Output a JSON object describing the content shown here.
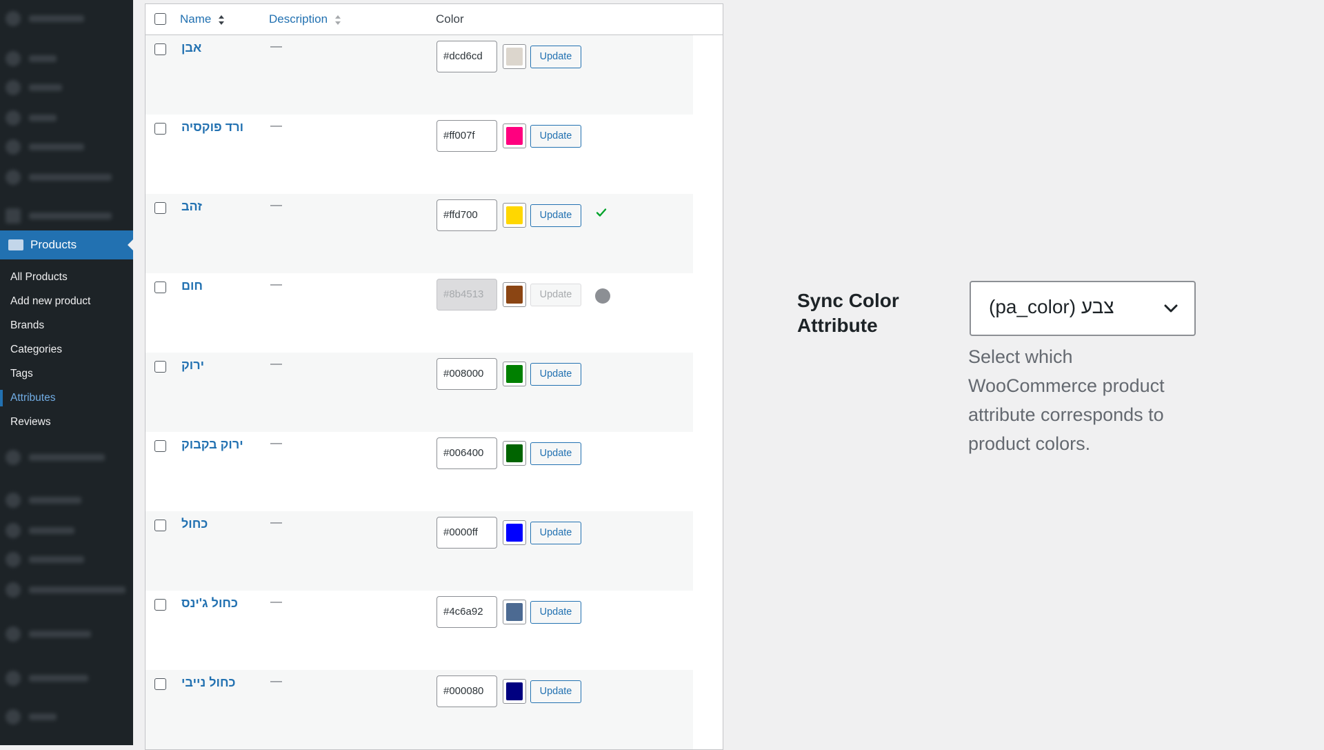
{
  "sidebar": {
    "products_label": "Products",
    "submenu": [
      {
        "label": "All Products"
      },
      {
        "label": "Add new product"
      },
      {
        "label": "Brands"
      },
      {
        "label": "Categories"
      },
      {
        "label": "Tags"
      },
      {
        "label": "Attributes",
        "active": true
      },
      {
        "label": "Reviews"
      }
    ]
  },
  "table": {
    "columns": {
      "name": "Name",
      "description": "Description",
      "color": "Color"
    },
    "update_label": "Update",
    "rows": [
      {
        "name": "אבן",
        "description": "—",
        "hex": "#dcd6cd",
        "swatch": "#dcd6cd",
        "status": "none"
      },
      {
        "name": "ורד פוקסיה",
        "description": "—",
        "hex": "#ff007f",
        "swatch": "#ff007f",
        "status": "none"
      },
      {
        "name": "זהב",
        "description": "—",
        "hex": "#ffd700",
        "swatch": "#ffd700",
        "status": "success"
      },
      {
        "name": "חום",
        "description": "—",
        "hex": "#8b4513",
        "swatch": "#8b4513",
        "status": "loading",
        "disabled": true
      },
      {
        "name": "ירוק",
        "description": "—",
        "hex": "#008000",
        "swatch": "#008000",
        "status": "none"
      },
      {
        "name": "ירוק בקבוק",
        "description": "—",
        "hex": "#006400",
        "swatch": "#006400",
        "status": "none"
      },
      {
        "name": "כחול",
        "description": "—",
        "hex": "#0000ff",
        "swatch": "#0000ff",
        "status": "none"
      },
      {
        "name": "כחול ג'ינס",
        "description": "—",
        "hex": "#4c6a92",
        "swatch": "#4c6a92",
        "status": "none"
      },
      {
        "name": "כחול נייבי",
        "description": "—",
        "hex": "#000080",
        "swatch": "#000080",
        "status": "none"
      }
    ]
  },
  "settings": {
    "sync_label": "Sync Color Attribute",
    "select_value": "צבע (pa_color)",
    "help_text": "Select which WooCommerce product attribute corresponds to product colors."
  }
}
